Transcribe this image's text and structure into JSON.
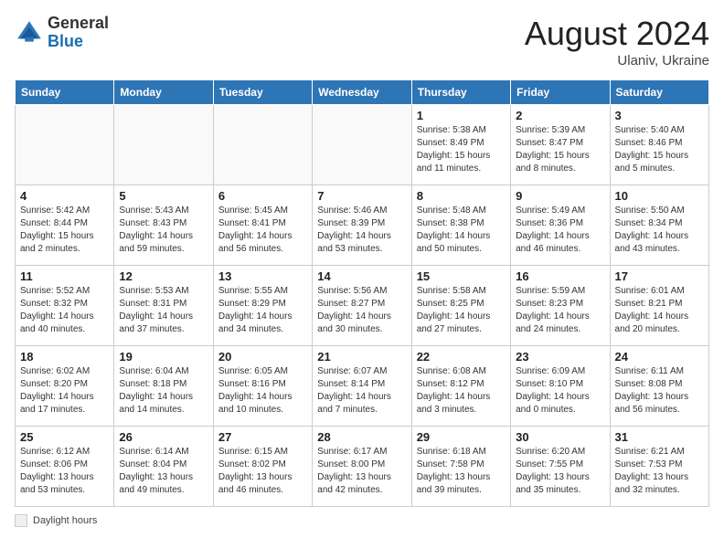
{
  "header": {
    "logo": {
      "general": "General",
      "blue": "Blue"
    },
    "month_year": "August 2024",
    "location": "Ulaniv, Ukraine"
  },
  "days_of_week": [
    "Sunday",
    "Monday",
    "Tuesday",
    "Wednesday",
    "Thursday",
    "Friday",
    "Saturday"
  ],
  "weeks": [
    [
      {
        "day": "",
        "info": ""
      },
      {
        "day": "",
        "info": ""
      },
      {
        "day": "",
        "info": ""
      },
      {
        "day": "",
        "info": ""
      },
      {
        "day": "1",
        "info": "Sunrise: 5:38 AM\nSunset: 8:49 PM\nDaylight: 15 hours\nand 11 minutes."
      },
      {
        "day": "2",
        "info": "Sunrise: 5:39 AM\nSunset: 8:47 PM\nDaylight: 15 hours\nand 8 minutes."
      },
      {
        "day": "3",
        "info": "Sunrise: 5:40 AM\nSunset: 8:46 PM\nDaylight: 15 hours\nand 5 minutes."
      }
    ],
    [
      {
        "day": "4",
        "info": "Sunrise: 5:42 AM\nSunset: 8:44 PM\nDaylight: 15 hours\nand 2 minutes."
      },
      {
        "day": "5",
        "info": "Sunrise: 5:43 AM\nSunset: 8:43 PM\nDaylight: 14 hours\nand 59 minutes."
      },
      {
        "day": "6",
        "info": "Sunrise: 5:45 AM\nSunset: 8:41 PM\nDaylight: 14 hours\nand 56 minutes."
      },
      {
        "day": "7",
        "info": "Sunrise: 5:46 AM\nSunset: 8:39 PM\nDaylight: 14 hours\nand 53 minutes."
      },
      {
        "day": "8",
        "info": "Sunrise: 5:48 AM\nSunset: 8:38 PM\nDaylight: 14 hours\nand 50 minutes."
      },
      {
        "day": "9",
        "info": "Sunrise: 5:49 AM\nSunset: 8:36 PM\nDaylight: 14 hours\nand 46 minutes."
      },
      {
        "day": "10",
        "info": "Sunrise: 5:50 AM\nSunset: 8:34 PM\nDaylight: 14 hours\nand 43 minutes."
      }
    ],
    [
      {
        "day": "11",
        "info": "Sunrise: 5:52 AM\nSunset: 8:32 PM\nDaylight: 14 hours\nand 40 minutes."
      },
      {
        "day": "12",
        "info": "Sunrise: 5:53 AM\nSunset: 8:31 PM\nDaylight: 14 hours\nand 37 minutes."
      },
      {
        "day": "13",
        "info": "Sunrise: 5:55 AM\nSunset: 8:29 PM\nDaylight: 14 hours\nand 34 minutes."
      },
      {
        "day": "14",
        "info": "Sunrise: 5:56 AM\nSunset: 8:27 PM\nDaylight: 14 hours\nand 30 minutes."
      },
      {
        "day": "15",
        "info": "Sunrise: 5:58 AM\nSunset: 8:25 PM\nDaylight: 14 hours\nand 27 minutes."
      },
      {
        "day": "16",
        "info": "Sunrise: 5:59 AM\nSunset: 8:23 PM\nDaylight: 14 hours\nand 24 minutes."
      },
      {
        "day": "17",
        "info": "Sunrise: 6:01 AM\nSunset: 8:21 PM\nDaylight: 14 hours\nand 20 minutes."
      }
    ],
    [
      {
        "day": "18",
        "info": "Sunrise: 6:02 AM\nSunset: 8:20 PM\nDaylight: 14 hours\nand 17 minutes."
      },
      {
        "day": "19",
        "info": "Sunrise: 6:04 AM\nSunset: 8:18 PM\nDaylight: 14 hours\nand 14 minutes."
      },
      {
        "day": "20",
        "info": "Sunrise: 6:05 AM\nSunset: 8:16 PM\nDaylight: 14 hours\nand 10 minutes."
      },
      {
        "day": "21",
        "info": "Sunrise: 6:07 AM\nSunset: 8:14 PM\nDaylight: 14 hours\nand 7 minutes."
      },
      {
        "day": "22",
        "info": "Sunrise: 6:08 AM\nSunset: 8:12 PM\nDaylight: 14 hours\nand 3 minutes."
      },
      {
        "day": "23",
        "info": "Sunrise: 6:09 AM\nSunset: 8:10 PM\nDaylight: 14 hours\nand 0 minutes."
      },
      {
        "day": "24",
        "info": "Sunrise: 6:11 AM\nSunset: 8:08 PM\nDaylight: 13 hours\nand 56 minutes."
      }
    ],
    [
      {
        "day": "25",
        "info": "Sunrise: 6:12 AM\nSunset: 8:06 PM\nDaylight: 13 hours\nand 53 minutes."
      },
      {
        "day": "26",
        "info": "Sunrise: 6:14 AM\nSunset: 8:04 PM\nDaylight: 13 hours\nand 49 minutes."
      },
      {
        "day": "27",
        "info": "Sunrise: 6:15 AM\nSunset: 8:02 PM\nDaylight: 13 hours\nand 46 minutes."
      },
      {
        "day": "28",
        "info": "Sunrise: 6:17 AM\nSunset: 8:00 PM\nDaylight: 13 hours\nand 42 minutes."
      },
      {
        "day": "29",
        "info": "Sunrise: 6:18 AM\nSunset: 7:58 PM\nDaylight: 13 hours\nand 39 minutes."
      },
      {
        "day": "30",
        "info": "Sunrise: 6:20 AM\nSunset: 7:55 PM\nDaylight: 13 hours\nand 35 minutes."
      },
      {
        "day": "31",
        "info": "Sunrise: 6:21 AM\nSunset: 7:53 PM\nDaylight: 13 hours\nand 32 minutes."
      }
    ]
  ],
  "legend": {
    "box_label": "Daylight hours"
  }
}
